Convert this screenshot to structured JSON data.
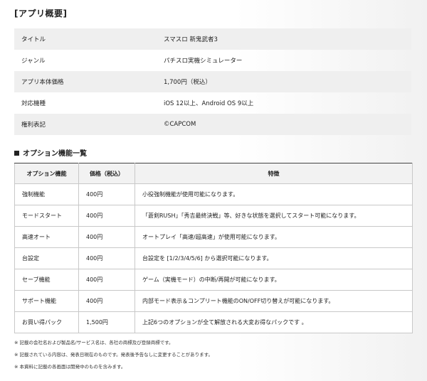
{
  "app_overview": {
    "heading": "[アプリ概要]",
    "rows": [
      {
        "label": "タイトル",
        "value": "スマスロ 新鬼武者3"
      },
      {
        "label": "ジャンル",
        "value": "パチスロ実機シミュレーター"
      },
      {
        "label": "アプリ本体価格",
        "value": "1,700円（税込）"
      },
      {
        "label": "対応機種",
        "value": "iOS 12以上、Android OS 9以上"
      },
      {
        "label": "権利表記",
        "value": "©CAPCOM"
      }
    ]
  },
  "options": {
    "heading": "オプション機能一覧",
    "headers": [
      "オプション機能",
      "価格（税込）",
      "特徴"
    ],
    "rows": [
      {
        "name": "強制機能",
        "price": "400円",
        "feature": "小役強制機能が使用可能になります。"
      },
      {
        "name": "モードスタート",
        "price": "400円",
        "feature": "「蒼剣RUSH」「秀吉最終決戦」等、好きな状態を選択してスタート可能になります。"
      },
      {
        "name": "高速オート",
        "price": "400円",
        "feature": "オートプレイ「高速/超高速」が使用可能になります。"
      },
      {
        "name": "台設定",
        "price": "400円",
        "feature": "台設定を [1/2/3/4/5/6] から選択可能になります。"
      },
      {
        "name": "セーブ機能",
        "price": "400円",
        "feature": "ゲーム（実機モード）の中断/再開が可能になります。"
      },
      {
        "name": "サポート機能",
        "price": "400円",
        "feature": "内部モード表示＆コンプリート機能のON/OFF切り替えが可能になります。"
      },
      {
        "name": "お買い得パック",
        "price": "1,500円",
        "feature": "上記6つのオプションが全て解放される大変お得なパックです 。"
      }
    ]
  },
  "notes": [
    "※ 記載の会社名および製品名/サービス名は、各社の商標及び登録商標です。",
    "※ 記載されている内容は、発表日現在のものです。発表後予告なしに変更することがあります。",
    "※ 本資料に記載の各画面は開発中のものを含みます。"
  ]
}
